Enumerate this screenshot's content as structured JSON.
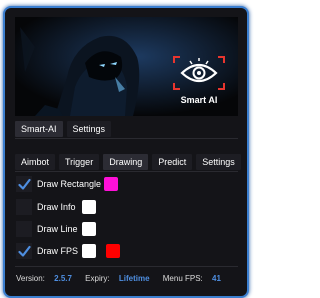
{
  "logo": {
    "text": "Smart AI",
    "icon": "eye-icon"
  },
  "main_tabs": [
    {
      "label": "Smart-AI",
      "active": true
    },
    {
      "label": "Settings",
      "active": false
    }
  ],
  "sub_tabs": [
    {
      "label": "Aimbot",
      "active": false
    },
    {
      "label": "Trigger",
      "active": false
    },
    {
      "label": "Drawing",
      "active": true
    },
    {
      "label": "Predict",
      "active": false
    },
    {
      "label": "Settings",
      "active": false
    }
  ],
  "options": [
    {
      "label": "Draw Rectangle",
      "checked": true,
      "colors": [
        "#ff10d8"
      ]
    },
    {
      "label": "Draw Info",
      "checked": false,
      "colors": [
        "#ffffff"
      ]
    },
    {
      "label": "Draw Line",
      "checked": false,
      "colors": [
        "#ffffff"
      ]
    },
    {
      "label": "Draw FPS",
      "checked": true,
      "colors": [
        "#ffffff",
        "#ff0000"
      ]
    }
  ],
  "footer": {
    "version_label": "Version:",
    "version_value": "2.5.7",
    "expiry_label": "Expiry:",
    "expiry_value": "Lifetime",
    "fps_label": "Menu FPS:",
    "fps_value": "41"
  },
  "colors": {
    "accent": "#4e8ee0",
    "border": "#3b7fd0",
    "background": "#141418"
  }
}
